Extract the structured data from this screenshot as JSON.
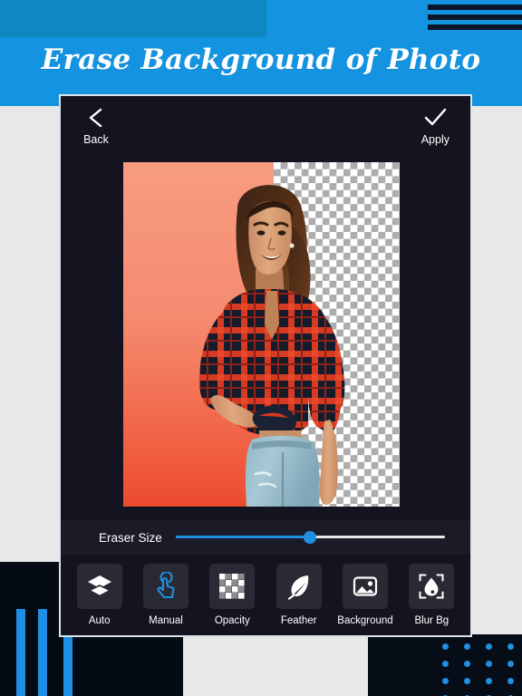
{
  "page": {
    "title": "Erase Background of Photo",
    "accent_blue": "#1393E0",
    "header_dark_blue": "#0E87C2",
    "page_bg": "#E8E8E8"
  },
  "app": {
    "topbar": {
      "back": {
        "label": "Back",
        "icon": "chevron-left-icon"
      },
      "apply": {
        "label": "Apply",
        "icon": "check-icon"
      }
    },
    "canvas": {
      "photo_description": "Smiling woman in red and black plaid shirt and blue jeans",
      "original_bg_color": "#F58B70",
      "erased_region_label": "transparent-checkerboard",
      "checker_light": "#FFFFFF",
      "checker_dark": "#ABABAB"
    },
    "slider": {
      "label": "Eraser Size",
      "value": 50,
      "min": 0,
      "max": 100,
      "fill_color": "#1E8FE3",
      "track_color": "#E9E9E9"
    },
    "toolbar": {
      "items": [
        {
          "label": "Auto",
          "icon": "layers-icon",
          "selected": false
        },
        {
          "label": "Manual",
          "icon": "touch-hand-icon",
          "selected": true
        },
        {
          "label": "Opacity",
          "icon": "checkerboard-icon",
          "selected": false
        },
        {
          "label": "Feather",
          "icon": "feather-icon",
          "selected": false
        },
        {
          "label": "Background",
          "icon": "image-icon",
          "selected": false
        },
        {
          "label": "Blur Bg",
          "icon": "droplet-focus-icon",
          "selected": false
        }
      ]
    }
  },
  "decor": {
    "header_lines_count": 3,
    "bottom_left_bars": 3,
    "bottom_right_dot_rows": 4,
    "bottom_right_dot_cols": 4,
    "dot_color": "#1E8FE3"
  }
}
